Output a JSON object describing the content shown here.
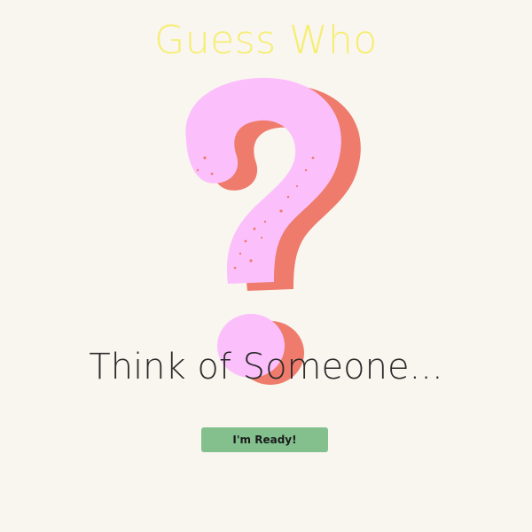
{
  "app": {
    "title": "Guess Who",
    "prompt": "Think of Someone...",
    "ready_button_label": "I'm Ready!"
  },
  "icons": {
    "hero": "question-mark-icon"
  },
  "colors": {
    "background": "#f9f5ef",
    "title": "#f6ee6d",
    "question_mark_front": "#fbc0fb",
    "question_mark_shadow": "#ef7b6c",
    "button": "#84c08e",
    "text": "#2b2b2b"
  }
}
